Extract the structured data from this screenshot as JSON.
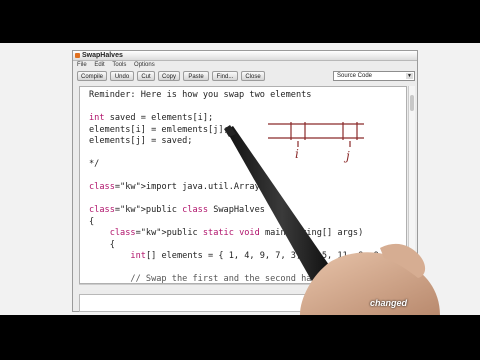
{
  "window": {
    "title": "SwapHalves"
  },
  "menu": [
    "File",
    "Edit",
    "Tools",
    "Options"
  ],
  "toolbar": {
    "compile": "Compile",
    "undo": "Undo",
    "cut": "Cut",
    "copy": "Copy",
    "paste": "Paste",
    "find": "Find...",
    "close": "Close"
  },
  "view_selector": {
    "selected": "Source Code"
  },
  "code_lines": [
    "Reminder: Here is how you swap two elements",
    "",
    "int saved = elements[i];",
    "elements[i] = emlements[j];",
    "elements[j] = saved;",
    "",
    "*/",
    "",
    "import java.util.Arrays;",
    "",
    "public class SwapHalves",
    "{",
    "    public static void main(String[] args)",
    "    {",
    "        int[] elements = { 1, 4, 9, 7, 3, 2, 5, 11, 8, 9 };",
    "",
    "        // Swap the first and the second half"
  ],
  "sketch": {
    "label_i": "i",
    "label_j": "j"
  },
  "status": {
    "changed": "changed"
  }
}
